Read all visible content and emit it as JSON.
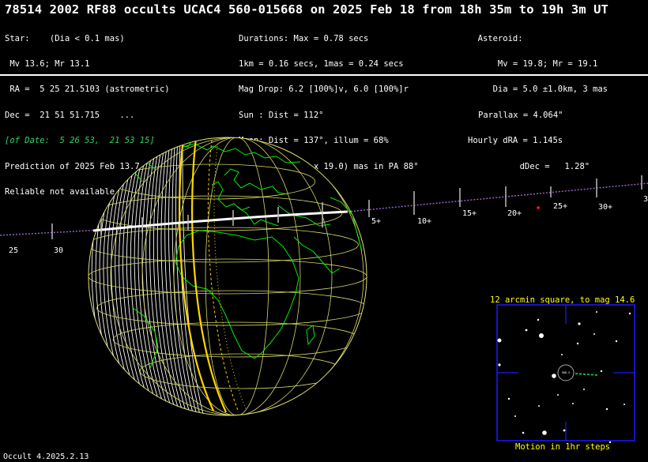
{
  "title": "78514 2002 RF88 occults UCAC4 560-015668 on 2025 Feb 18 from 18h 35m to 19h  3m UT",
  "star": {
    "line1": "Star:    (Dia < 0.1 mas)",
    "line2": " Mv 13.6; Mr 13.1",
    "line3": " RA =  5 25 21.5103 (astrometric)",
    "line4": "Dec =  21 51 51.715    ...",
    "line5": "[of Date:  5 26 53,  21 53 15]",
    "line6": "Prediction of 2025 Feb 13.7",
    "line7": "Reliable not available"
  },
  "event": {
    "line1": "Durations: Max = 0.78 secs",
    "line2": "1km = 0.16 secs, 1mas = 0.24 secs",
    "line3": "Mag Drop: 6.2 [100%]v, 6.0 [100%]r",
    "line4": "Sun : Dist = 112°",
    "line5": "Moon: Dist = 137°, illum = 68%",
    "line6": "1σ Err: ±(29.0 x 19.0) mas in PA 88°"
  },
  "asteroid": {
    "line1": "  Asteroid:",
    "line2": "      Mv = 19.8; Mr = 19.1",
    "line3": "     Dia = 5.0 ±1.0km, 3 mas",
    "line4": "Parallax = 4.064\"",
    "line5": "Hourly dRA = 1.145s",
    "line6": "     dDec =   1.28\""
  },
  "path_labels": {
    "left": [
      "25",
      "30"
    ],
    "right": [
      "5+",
      "10+",
      "15+",
      "20+",
      "25+",
      "30+",
      "3"
    ]
  },
  "star_chart": {
    "title": "12 arcmin square, to mag 14.6",
    "caption": "Motion in 1hr steps",
    "target_label": "560-5"
  },
  "footer": "Occult 4.2025.2.13",
  "colors": {
    "background": "#000000",
    "coastline": "#00ff00",
    "grid": "#e0e070",
    "shadow_edge": "#ffd700",
    "track": "#9a6ad0",
    "chart_border": "#1a1aff",
    "chart_text": "#ffff00"
  }
}
